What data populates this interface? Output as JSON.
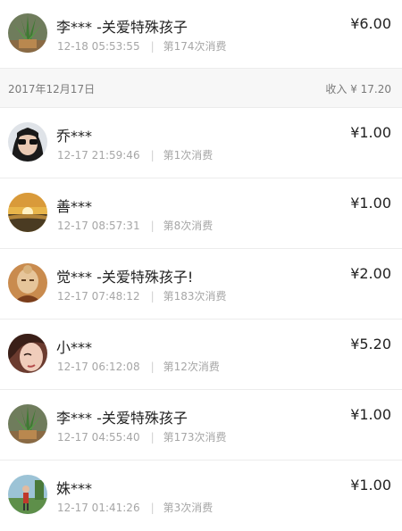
{
  "top_entry": {
    "name": "李*** -关爱特殊孩子",
    "time": "12-18 05:53:55",
    "count": "第174次消费",
    "amount": "¥6.00",
    "avatar": "potted-plant-avatar"
  },
  "date_group": {
    "date": "2017年12月17日",
    "income": "收入 ¥ 17.20",
    "entries": [
      {
        "name": "乔***",
        "time": "12-17 21:59:46",
        "count": "第1次消费",
        "amount": "¥1.00",
        "avatar": "woman-sunglasses-avatar"
      },
      {
        "name": "善***",
        "time": "12-17 08:57:31",
        "count": "第8次消费",
        "amount": "¥1.00",
        "avatar": "sunset-avatar"
      },
      {
        "name": "觉*** -关爱特殊孩子!",
        "time": "12-17 07:48:12",
        "count": "第183次消费",
        "amount": "¥2.00",
        "avatar": "buddha-statue-avatar"
      },
      {
        "name": "小***",
        "time": "12-17 06:12:08",
        "count": "第12次消费",
        "amount": "¥5.20",
        "avatar": "woman-face-avatar"
      },
      {
        "name": "李*** -关爱特殊孩子",
        "time": "12-17 04:55:40",
        "count": "第173次消费",
        "amount": "¥1.00",
        "avatar": "potted-plant-avatar"
      },
      {
        "name": "姝***",
        "time": "12-17 01:41:26",
        "count": "第3次消费",
        "amount": "¥1.00",
        "avatar": "person-outdoor-avatar"
      }
    ]
  }
}
